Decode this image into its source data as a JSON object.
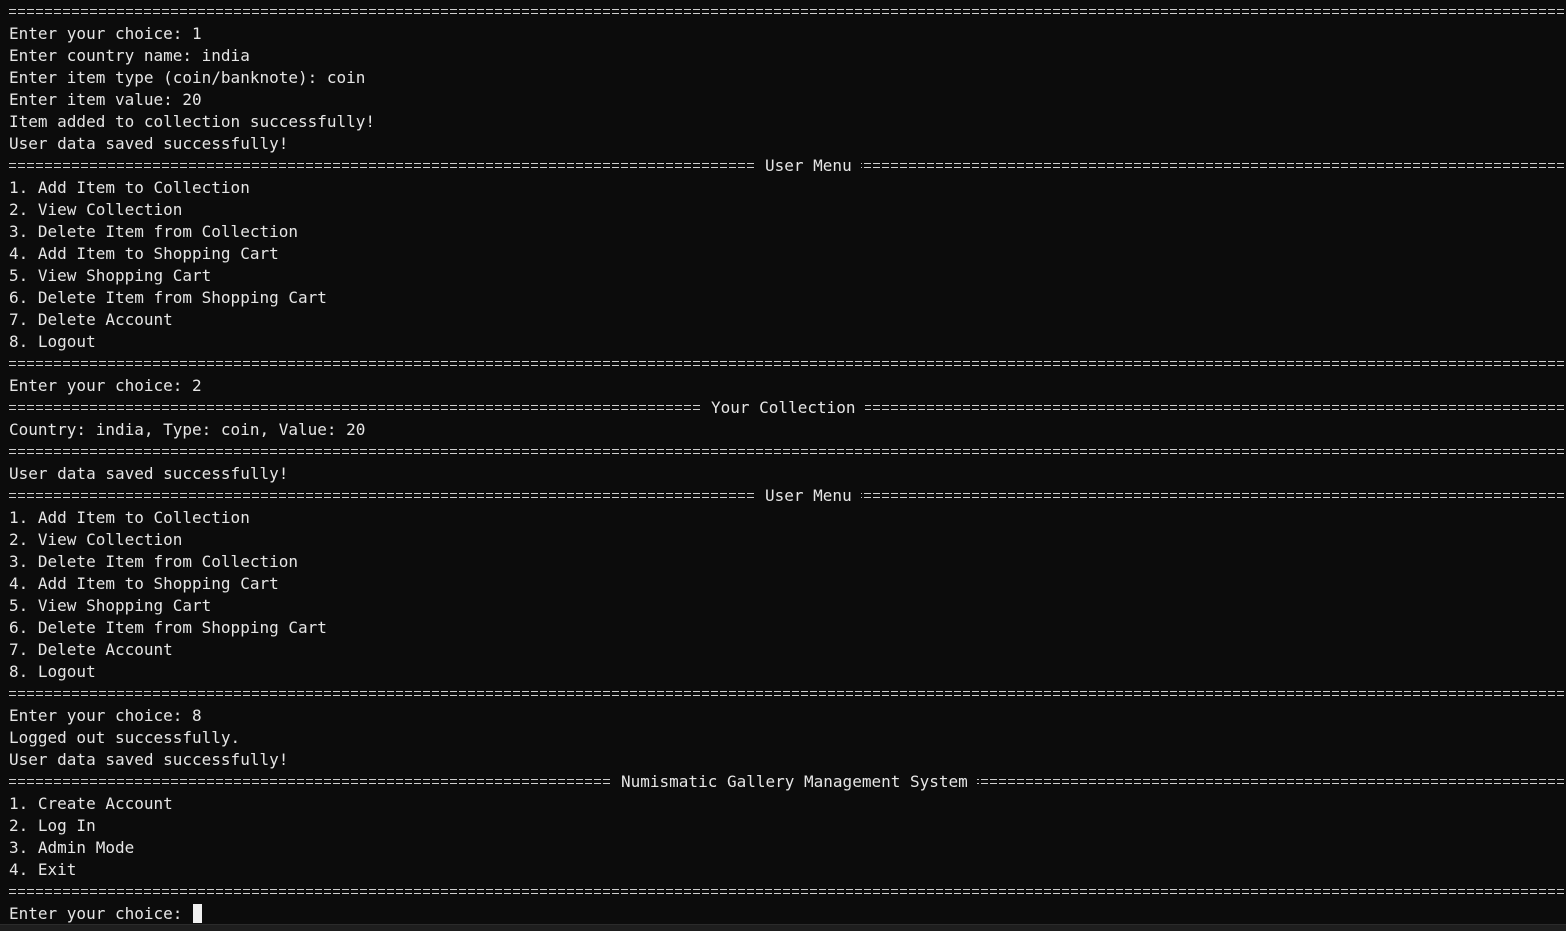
{
  "terminal": {
    "session1": {
      "lines": [
        "Enter your choice: 1",
        "Enter country name: india",
        "Enter item type (coin/banknote): coin",
        "Enter item value: 20",
        "Item added to collection successfully!",
        "User data saved successfully!"
      ]
    },
    "user_menu_title": "User Menu",
    "user_menu_items": [
      "1. Add Item to Collection",
      "2. View Collection",
      "3. Delete Item from Collection",
      "4. Add Item to Shopping Cart",
      "5. View Shopping Cart",
      "6. Delete Item from Shopping Cart",
      "7. Delete Account",
      "8. Logout"
    ],
    "choice_2": "Enter your choice: 2",
    "collection_title": "Your Collection",
    "collection_item": "Country: india, Type: coin, Value: 20",
    "saved_msg": "User data saved successfully!",
    "choice_8": "Enter your choice: 8",
    "logged_out": "Logged out successfully.",
    "main_menu_title": "Numismatic Gallery Management System",
    "main_menu_items": [
      "1. Create Account",
      "2. Log In",
      "3. Admin Mode",
      "4. Exit"
    ],
    "final_prompt": "Enter your choice: "
  }
}
